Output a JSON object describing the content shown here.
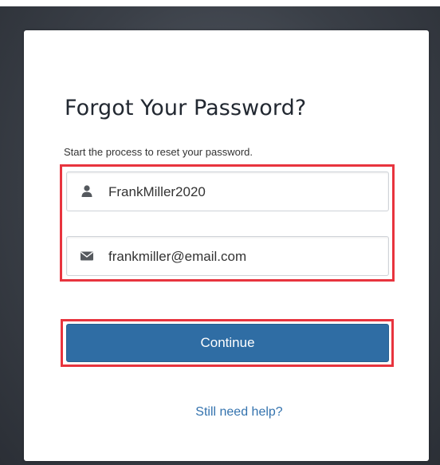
{
  "dialog": {
    "title": "Forgot Your Password?",
    "subtitle": "Start the process to reset your password."
  },
  "form": {
    "username": {
      "icon": "user-icon",
      "value": "FrankMiller2020"
    },
    "email": {
      "icon": "envelope-icon",
      "value": "frankmiller@email.com"
    },
    "continue_label": "Continue",
    "help_link": "Still need help?"
  },
  "colors": {
    "button": "#2f6da4",
    "link": "#3473ae",
    "highlight": "#e8343e"
  }
}
